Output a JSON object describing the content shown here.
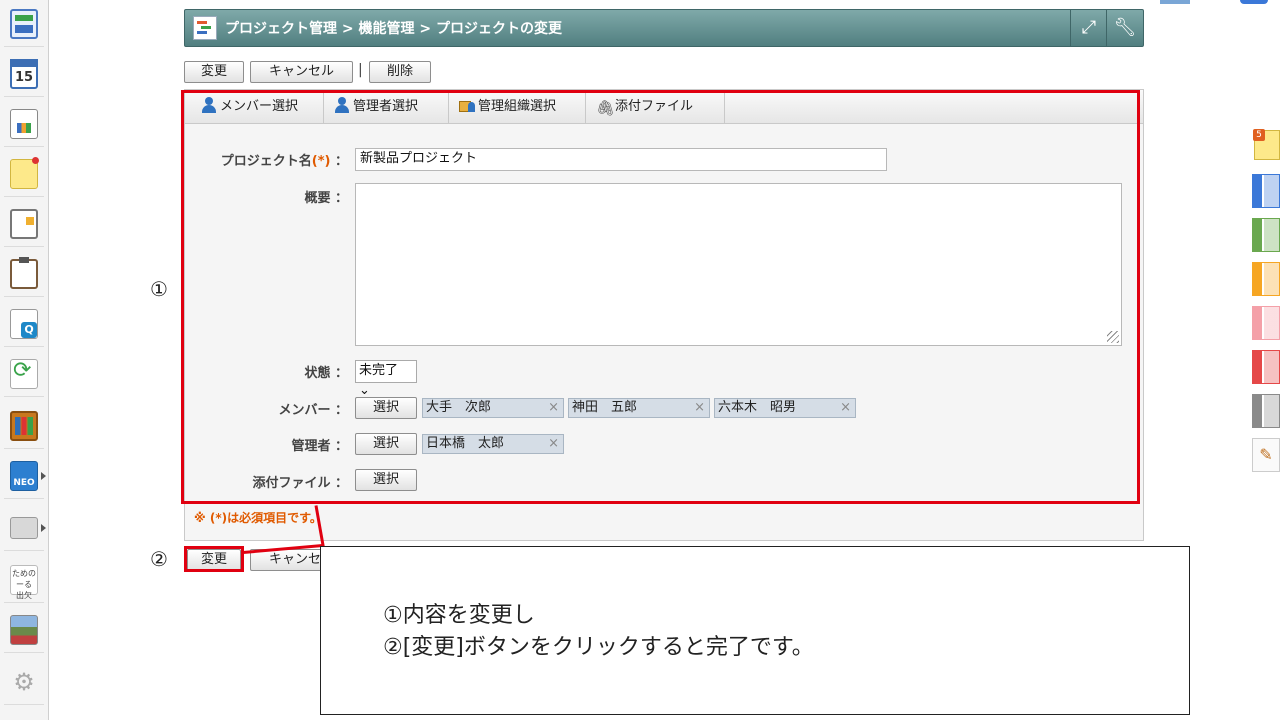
{
  "breadcrumb": "プロジェクト管理 > 機能管理 > プロジェクトの変更",
  "icons": {
    "title_app": "project-icon",
    "fullscreen": "fullscreen-icon",
    "settings": "wrench-icon"
  },
  "toolbar": {
    "change_label": "変更",
    "cancel_label": "キャンセル",
    "separator": "|",
    "delete_label": "削除"
  },
  "tabs": [
    {
      "label": "メンバー選択",
      "icon": "user-icon"
    },
    {
      "label": "管理者選択",
      "icon": "user-icon"
    },
    {
      "label": "管理組織選択",
      "icon": "org-icon"
    },
    {
      "label": "添付ファイル",
      "icon": "paperclip-icon"
    }
  ],
  "form": {
    "project_name_label": "プロジェクト名",
    "required_mark": "(*)",
    "colon": "：",
    "project_name_value": "新製品プロジェクト",
    "summary_label": "概要",
    "summary_value": "",
    "status_label": "状態",
    "status_value": "未完了",
    "members_label": "メンバー",
    "select_label": "選択",
    "members": [
      "大手　次郎",
      "神田　五郎",
      "六本木　昭男"
    ],
    "admin_label": "管理者",
    "admins": [
      "日本橋　太郎"
    ],
    "attachment_label": "添付ファイル",
    "remove_glyph": "×"
  },
  "required_note": "※ (*)は必須項目です。",
  "bottom_toolbar": {
    "change_label": "変更",
    "cancel_label": "キャンセル"
  },
  "annotations": {
    "marker_1": "①",
    "marker_2": "②",
    "callout_line1": "①内容を変更し",
    "callout_line2": "②[変更]ボタンをクリックすると完了です。",
    "frame_color": "#e00010"
  },
  "sidebar": {
    "items": [
      "dashboard-icon",
      "calendar-icon",
      "report-icon",
      "memo-icon",
      "board-icon",
      "clipboard-icon",
      "checklist-icon",
      "workflow-icon",
      "cabinet-icon",
      "neo-icon",
      "folder-icon",
      "text-app-icon",
      "photo-app-icon",
      "gear-icon"
    ],
    "calendar_day": "15",
    "neo_text": "NEO",
    "text_app_text": "ためのーる\n出欠"
  },
  "right_edge": {
    "badge_count": "5",
    "colors": [
      "#3b78d8",
      "#6aa84f",
      "#f6a623",
      "#f4a0a8",
      "#e54848",
      "#8a8a8a"
    ]
  }
}
